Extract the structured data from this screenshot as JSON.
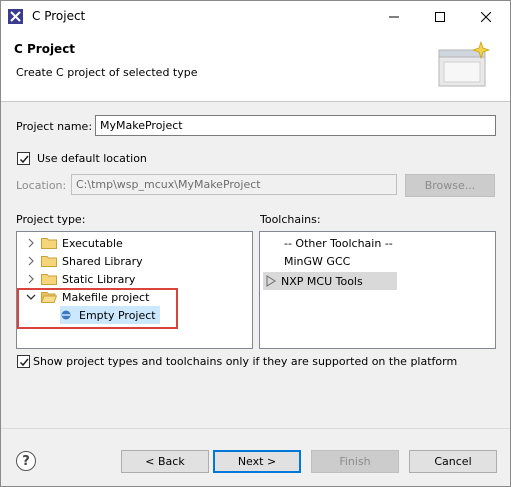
{
  "window": {
    "title": "C Project"
  },
  "banner": {
    "title": "C Project",
    "description": "Create C project of selected type"
  },
  "form": {
    "project_name_label": "Project name:",
    "project_name_value": "MyMakeProject",
    "use_default_label": "Use default location",
    "location_label": "Location:",
    "location_value": "C:\\tmp\\wsp_mcux\\MyMakeProject",
    "browse_label": "Browse..."
  },
  "project_type": {
    "header": "Project type:",
    "items": [
      {
        "label": "Executable",
        "expanded": false
      },
      {
        "label": "Shared Library",
        "expanded": false
      },
      {
        "label": "Static Library",
        "expanded": false
      },
      {
        "label": "Makefile project",
        "expanded": true
      },
      {
        "label": "Empty Project",
        "selected": true
      }
    ]
  },
  "toolchains": {
    "header": "Toolchains:",
    "items": [
      {
        "label": "-- Other Toolchain --"
      },
      {
        "label": "MinGW GCC"
      },
      {
        "label": "NXP MCU Tools",
        "selected": true
      }
    ]
  },
  "show_supported_label": "Show project types and toolchains only if they are supported on the platform",
  "buttons": {
    "back": "< Back",
    "next": "Next >",
    "finish": "Finish",
    "cancel": "Cancel"
  },
  "help": "?",
  "colors": {
    "highlight_box": "#d9443d",
    "selection": "#cce8ff",
    "default_button_border": "#0078d7"
  }
}
